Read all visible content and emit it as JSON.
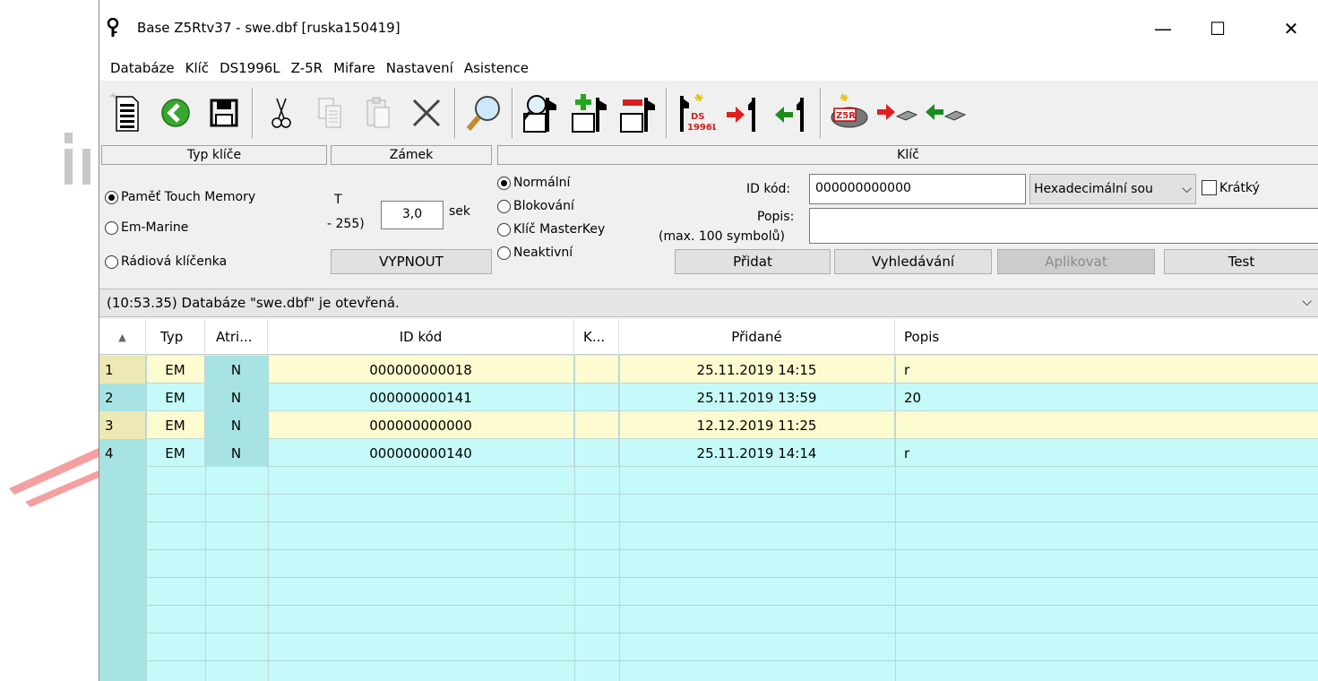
{
  "window": {
    "title": "Base Z5Rtv37 - swe.dbf [ruska150419]",
    "minimize": "—",
    "maximize": "☐",
    "close": "✕"
  },
  "menu": [
    "Databáze",
    "Klíč",
    "DS1996L",
    "Z-5R",
    "Mifare",
    "Nastavení",
    "Asistence"
  ],
  "toolbar_icons": [
    "new-document-icon",
    "back-arrow-icon",
    "save-icon",
    "cut-icon",
    "copy-icon",
    "paste-icon",
    "delete-icon",
    "search-icon",
    "find-key-icon",
    "add-key-icon",
    "remove-key-icon",
    "ds1996l-icon",
    "key-write-icon",
    "key-read-icon",
    "z5r-icon",
    "chip-write-icon",
    "chip-read-icon"
  ],
  "sections": {
    "typ": "Typ klíče",
    "zamek": "Zámek",
    "klic": "Klíč"
  },
  "typ_klice": {
    "options": [
      "Paměť Touch Memory",
      "Em-Marine",
      "Rádiová klíčenka"
    ],
    "selected": 0
  },
  "zamek": {
    "label_t": "T",
    "label_range": "- 255)",
    "value": "3,0",
    "unit": "sek",
    "button": "VYPNOUT"
  },
  "klic": {
    "modes": [
      "Normální",
      "Blokování",
      "Klíč MasterKey",
      "Neaktivní"
    ],
    "selected_mode": 0,
    "id_label": "ID kód:",
    "id_value": "000000000000",
    "format": "Hexadecimální sou",
    "short_label": "Krátký",
    "popis_label": "Popis:",
    "popis_hint": "(max. 100 symbolů)",
    "popis_value": "",
    "buttons": {
      "add": "Přidat",
      "search": "Vyhledávání",
      "apply": "Aplikovat",
      "test": "Test"
    }
  },
  "status": {
    "text": "(10:53.35) Databáze \"swe.dbf\" je otevřená."
  },
  "grid": {
    "columns": [
      "▲",
      "Typ",
      "Atri...",
      "ID kód",
      "K...",
      "Přidané",
      "Popis"
    ],
    "rows": [
      {
        "idx": "1",
        "typ": "EM",
        "atr": "N",
        "id": "000000000018",
        "k": "",
        "added": "25.11.2019 14:15",
        "popis": "r"
      },
      {
        "idx": "2",
        "typ": "EM",
        "atr": "N",
        "id": "000000000141",
        "k": "",
        "added": "25.11.2019 13:59",
        "popis": "20"
      },
      {
        "idx": "3",
        "typ": "EM",
        "atr": "N",
        "id": "000000000000",
        "k": "",
        "added": "12.12.2019 11:25",
        "popis": ""
      },
      {
        "idx": "4",
        "typ": "EM",
        "atr": "N",
        "id": "000000000140",
        "k": "",
        "added": "25.11.2019 14:14",
        "popis": "r"
      }
    ]
  },
  "colors": {
    "row_yellow": "#fdfbd0",
    "row_cyan": "#c6fafa",
    "index_cyan": "#a8e3e3"
  }
}
